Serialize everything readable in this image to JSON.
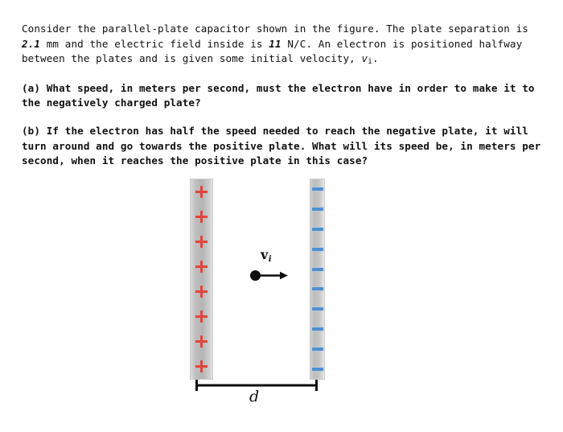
{
  "problem": {
    "intro": {
      "part1": "Consider the parallel-plate capacitor shown in the figure. The plate separation is ",
      "separation_value": "2.1",
      "part2": " mm and the electric field inside is ",
      "field_value": "11",
      "part3": " N/C. An electron is positioned halfway between the plates and is given some initial velocity, ",
      "velocity_symbol": "v",
      "velocity_subscript": "i",
      "part4": "."
    },
    "question_a": "(a) What speed, in meters per second, must the electron have in order to make it to the negatively charged plate?",
    "question_b": "(b) If the electron has half the speed needed to reach the negative plate, it will turn around and go towards the positive plate. What will its speed be, in meters per second, when it reaches the positive plate in this case?"
  },
  "figure": {
    "positive_plate": {
      "label": "positive plate",
      "charge_symbol": "+",
      "charge_count": 8,
      "color": "#e0453c"
    },
    "negative_plate": {
      "label": "negative plate",
      "charge_symbol": "−",
      "charge_count": 10,
      "color": "#4f8fd0"
    },
    "electron": {
      "label": "electron",
      "color": "#0d0d0d"
    },
    "velocity": {
      "symbol": "v",
      "subscript": "i"
    },
    "separation": {
      "label": "d"
    }
  },
  "colors": {
    "background": "#ffffff",
    "text": "#101010",
    "plus": "#e0453c",
    "minus": "#4f8fd0",
    "plate": "#bfbfbf"
  }
}
